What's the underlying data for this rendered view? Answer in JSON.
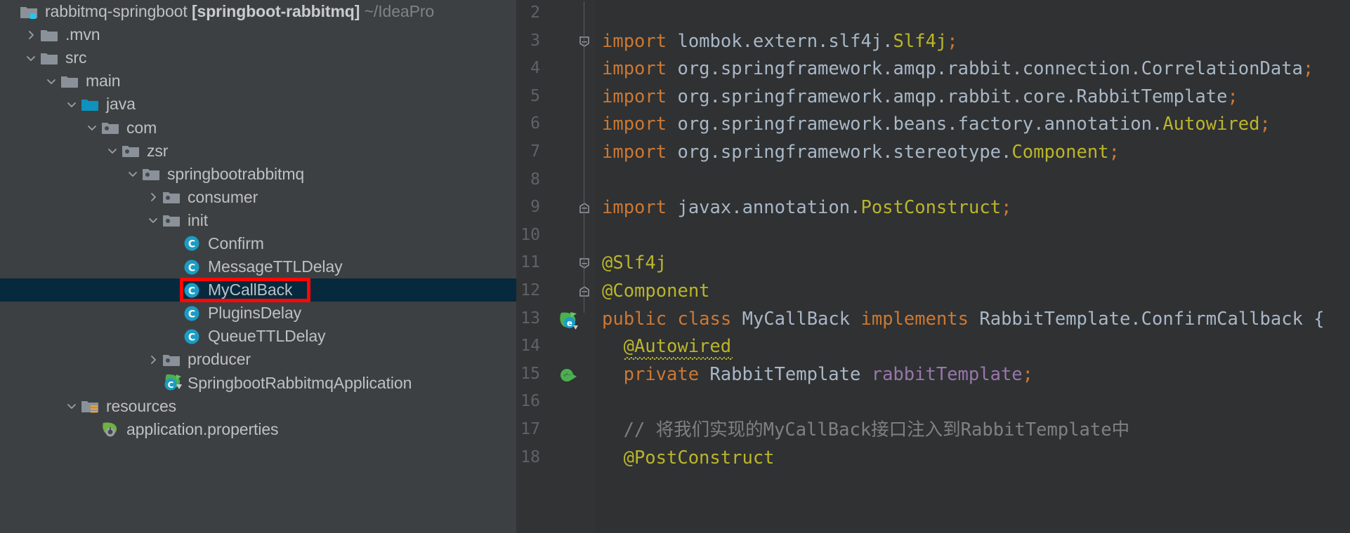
{
  "sidebar": {
    "name": "project-tool-window",
    "rows": [
      {
        "id": "root",
        "depth": 0,
        "arrow": "none",
        "icon": "module-folder-icon",
        "label": "rabbitmq-springboot ",
        "bold": "[springboot-rabbitmq]",
        "dim": " ~/IdeaPro"
      },
      {
        "id": "mvn",
        "depth": 1,
        "arrow": "collapsed",
        "icon": "folder-icon",
        "label": ".mvn"
      },
      {
        "id": "src",
        "depth": 1,
        "arrow": "expanded",
        "icon": "folder-icon",
        "label": "src"
      },
      {
        "id": "main",
        "depth": 2,
        "arrow": "expanded",
        "icon": "folder-icon",
        "label": "main"
      },
      {
        "id": "java",
        "depth": 3,
        "arrow": "expanded",
        "icon": "source-root-folder-icon",
        "label": "java"
      },
      {
        "id": "com",
        "depth": 4,
        "arrow": "expanded",
        "icon": "package-icon",
        "label": "com"
      },
      {
        "id": "zsr",
        "depth": 5,
        "arrow": "expanded",
        "icon": "package-icon",
        "label": "zsr"
      },
      {
        "id": "sbrmq",
        "depth": 6,
        "arrow": "expanded",
        "icon": "package-icon",
        "label": "springbootrabbitmq"
      },
      {
        "id": "consumer",
        "depth": 7,
        "arrow": "collapsed",
        "icon": "package-icon",
        "label": "consumer"
      },
      {
        "id": "init",
        "depth": 7,
        "arrow": "expanded",
        "icon": "package-icon",
        "label": "init"
      },
      {
        "id": "confirm",
        "depth": 8,
        "arrow": "none",
        "icon": "java-class-icon",
        "label": "Confirm"
      },
      {
        "id": "msgttl",
        "depth": 8,
        "arrow": "none",
        "icon": "java-class-icon",
        "label": "MessageTTLDelay"
      },
      {
        "id": "mycallback",
        "depth": 8,
        "arrow": "none",
        "icon": "java-class-icon",
        "label": "MyCallBack",
        "selected": true
      },
      {
        "id": "plugins",
        "depth": 8,
        "arrow": "none",
        "icon": "java-class-icon",
        "label": "PluginsDelay"
      },
      {
        "id": "queuettl",
        "depth": 8,
        "arrow": "none",
        "icon": "java-class-icon",
        "label": "QueueTTLDelay"
      },
      {
        "id": "producer",
        "depth": 7,
        "arrow": "collapsed",
        "icon": "package-icon",
        "label": "producer"
      },
      {
        "id": "sbapp",
        "depth": 7,
        "arrow": "none",
        "icon": "spring-boot-class-icon",
        "label": "SpringbootRabbitmqApplication"
      },
      {
        "id": "resources",
        "depth": 3,
        "arrow": "expanded",
        "icon": "resources-root-folder-icon",
        "label": "resources"
      },
      {
        "id": "appprops",
        "depth": 4,
        "arrow": "none",
        "icon": "spring-properties-icon",
        "label": "application.properties"
      }
    ]
  },
  "editor": {
    "name": "code-editor",
    "first_line_number": 2,
    "lines": [
      {
        "n": 2,
        "fold": "none",
        "gutter": "none",
        "tokens": []
      },
      {
        "n": 3,
        "fold": "start",
        "gutter": "none",
        "tokens": [
          {
            "t": "import ",
            "c": "kw"
          },
          {
            "t": "lombok.extern.slf4j.",
            "c": "txt"
          },
          {
            "t": "Slf4j",
            "c": "anno"
          },
          {
            "t": ";",
            "c": "punc"
          }
        ]
      },
      {
        "n": 4,
        "fold": "line",
        "gutter": "none",
        "tokens": [
          {
            "t": "import ",
            "c": "kw"
          },
          {
            "t": "org.springframework.amqp.rabbit.connection.CorrelationData",
            "c": "txt"
          },
          {
            "t": ";",
            "c": "punc"
          }
        ]
      },
      {
        "n": 5,
        "fold": "line",
        "gutter": "none",
        "tokens": [
          {
            "t": "import ",
            "c": "kw"
          },
          {
            "t": "org.springframework.amqp.rabbit.core.RabbitTemplate",
            "c": "txt"
          },
          {
            "t": ";",
            "c": "punc"
          }
        ]
      },
      {
        "n": 6,
        "fold": "line",
        "gutter": "none",
        "tokens": [
          {
            "t": "import ",
            "c": "kw"
          },
          {
            "t": "org.springframework.beans.factory.annotation.",
            "c": "txt"
          },
          {
            "t": "Autowired",
            "c": "anno"
          },
          {
            "t": ";",
            "c": "punc"
          }
        ]
      },
      {
        "n": 7,
        "fold": "line",
        "gutter": "none",
        "tokens": [
          {
            "t": "import ",
            "c": "kw"
          },
          {
            "t": "org.springframework.stereotype.",
            "c": "txt"
          },
          {
            "t": "Component",
            "c": "anno"
          },
          {
            "t": ";",
            "c": "punc"
          }
        ]
      },
      {
        "n": 8,
        "fold": "line",
        "gutter": "none",
        "tokens": []
      },
      {
        "n": 9,
        "fold": "end",
        "gutter": "none",
        "tokens": [
          {
            "t": "import ",
            "c": "kw"
          },
          {
            "t": "javax.annotation.",
            "c": "txt"
          },
          {
            "t": "PostConstruct",
            "c": "anno"
          },
          {
            "t": ";",
            "c": "punc"
          }
        ]
      },
      {
        "n": 10,
        "fold": "none",
        "gutter": "none",
        "tokens": []
      },
      {
        "n": 11,
        "fold": "start",
        "gutter": "none",
        "tokens": [
          {
            "t": "@Slf4j",
            "c": "anno"
          }
        ]
      },
      {
        "n": 12,
        "fold": "end",
        "gutter": "none",
        "tokens": [
          {
            "t": "@Component",
            "c": "anno"
          }
        ]
      },
      {
        "n": 13,
        "fold": "none",
        "gutter": "spring-bean-icon",
        "tokens": [
          {
            "t": "public ",
            "c": "kw"
          },
          {
            "t": "class ",
            "c": "kw"
          },
          {
            "t": "MyCallBack ",
            "c": "txt"
          },
          {
            "t": "implements ",
            "c": "kw"
          },
          {
            "t": "RabbitTemplate.ConfirmCallback {",
            "c": "txt"
          }
        ]
      },
      {
        "n": 14,
        "fold": "none",
        "gutter": "none",
        "warn": true,
        "indent": 2,
        "tokens": [
          {
            "t": "@Autowired",
            "c": "anno"
          }
        ]
      },
      {
        "n": 15,
        "fold": "none",
        "gutter": "green-arrow-icon",
        "indent": 2,
        "tokens": [
          {
            "t": "private ",
            "c": "kw"
          },
          {
            "t": "RabbitTemplate ",
            "c": "txt"
          },
          {
            "t": "rabbitTemplate",
            "c": "fld"
          },
          {
            "t": ";",
            "c": "punc"
          }
        ]
      },
      {
        "n": 16,
        "fold": "none",
        "gutter": "none",
        "tokens": []
      },
      {
        "n": 17,
        "fold": "none",
        "gutter": "none",
        "indent": 2,
        "tokens": [
          {
            "t": "// 将我们实现的MyCallBack接口注入到RabbitTemplate中",
            "c": "cmt"
          }
        ]
      },
      {
        "n": 18,
        "fold": "none",
        "gutter": "none",
        "indent": 2,
        "tokens": [
          {
            "t": "@PostConstruct",
            "c": "anno"
          }
        ]
      }
    ]
  },
  "annotation": {
    "name": "red-highlight-box",
    "color": "#ff0707",
    "target": "MyCallBack"
  },
  "colors": {
    "sidebar_bg": "#3c4043",
    "editor_bg": "#2f3133",
    "gutter_bg": "#313335",
    "selection_bg": "#06293d",
    "keyword": "#cc7832",
    "text": "#a9b7c6",
    "annotation": "#bbb529",
    "comment": "#808080",
    "field": "#9876aa",
    "line_number": "#606366",
    "tree_text": "#bec0c2",
    "class_icon": "#1b9cc4",
    "folder_icon": "#8a9199",
    "source_root_icon": "#0d93bd",
    "spring_green": "#4caf50",
    "accent_red": "#ff0707"
  }
}
